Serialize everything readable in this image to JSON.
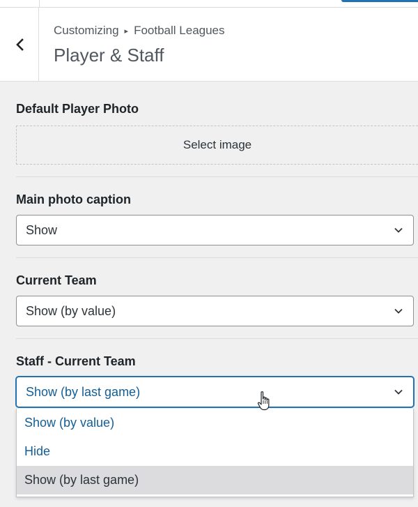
{
  "header": {
    "breadcrumb_root": "Customizing",
    "breadcrumb_separator": "▸",
    "breadcrumb_section": "Football Leagues",
    "title": "Player & Staff"
  },
  "controls": {
    "default_photo": {
      "label": "Default Player Photo",
      "button": "Select image"
    },
    "main_caption": {
      "label": "Main photo caption",
      "value": "Show"
    },
    "current_team": {
      "label": "Current Team",
      "value": "Show (by value)"
    },
    "staff_current_team": {
      "label": "Staff - Current Team",
      "value": "Show (by last game)",
      "options": [
        "Show (by value)",
        "Hide",
        "Show (by last game)"
      ]
    }
  },
  "colors": {
    "accent": "#2271b1",
    "link": "#135e96",
    "panel_bg": "#f0f0f1"
  }
}
